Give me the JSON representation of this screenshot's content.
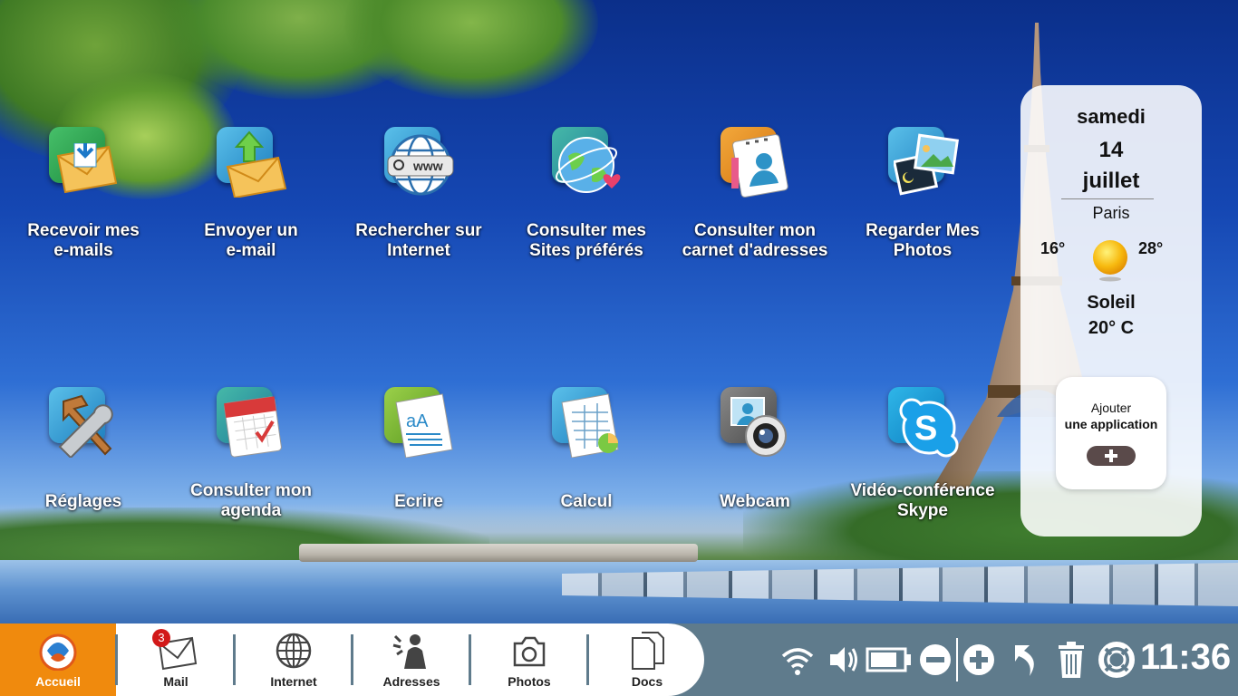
{
  "desktop": {
    "apps_row1": [
      {
        "label": "Recevoir mes\ne-mails",
        "icon": "receive-mail-icon"
      },
      {
        "label": "Envoyer un\ne-mail",
        "icon": "send-mail-icon"
      },
      {
        "label": "Rechercher sur\nInternet",
        "icon": "web-search-icon"
      },
      {
        "label": "Consulter mes\nSites préférés",
        "icon": "favorite-sites-icon"
      },
      {
        "label": "Consulter mon\ncarnet d'adresses",
        "icon": "address-book-icon"
      },
      {
        "label": "Regarder Mes\nPhotos",
        "icon": "photos-icon"
      }
    ],
    "apps_row2": [
      {
        "label": "Réglages",
        "icon": "settings-tools-icon"
      },
      {
        "label": "Consulter mon\nagenda",
        "icon": "calendar-icon"
      },
      {
        "label": "Ecrire",
        "icon": "writer-icon"
      },
      {
        "label": "Calcul",
        "icon": "spreadsheet-icon"
      },
      {
        "label": "Webcam",
        "icon": "webcam-icon"
      },
      {
        "label": "Vidéo-conférence\nSkype",
        "icon": "skype-icon"
      }
    ]
  },
  "weather": {
    "day": "samedi",
    "date": "14",
    "month": "juillet",
    "city": "Paris",
    "temp_min": "16°",
    "temp_max": "28°",
    "condition": "Soleil",
    "temperature": "20° C",
    "add_app_line1": "Ajouter",
    "add_app_line2": "une application"
  },
  "taskbar": {
    "dock": [
      {
        "label": "Accueil",
        "icon": "home-icon",
        "active": true
      },
      {
        "label": "Mail",
        "icon": "mail-icon",
        "badge": "3"
      },
      {
        "label": "Internet",
        "icon": "globe-icon"
      },
      {
        "label": "Adresses",
        "icon": "contacts-icon"
      },
      {
        "label": "Photos",
        "icon": "camera-icon"
      },
      {
        "label": "Docs",
        "icon": "documents-icon"
      }
    ],
    "system_icons": [
      "wifi-icon",
      "volume-icon",
      "battery-icon",
      "zoom-out-icon",
      "zoom-in-icon",
      "back-icon",
      "trash-icon",
      "help-lifebuoy-icon"
    ],
    "clock": "11:36"
  },
  "colors": {
    "accent_orange": "#f08a0d",
    "taskbar_bg": "#5f7b8c",
    "badge_red": "#d21919"
  }
}
